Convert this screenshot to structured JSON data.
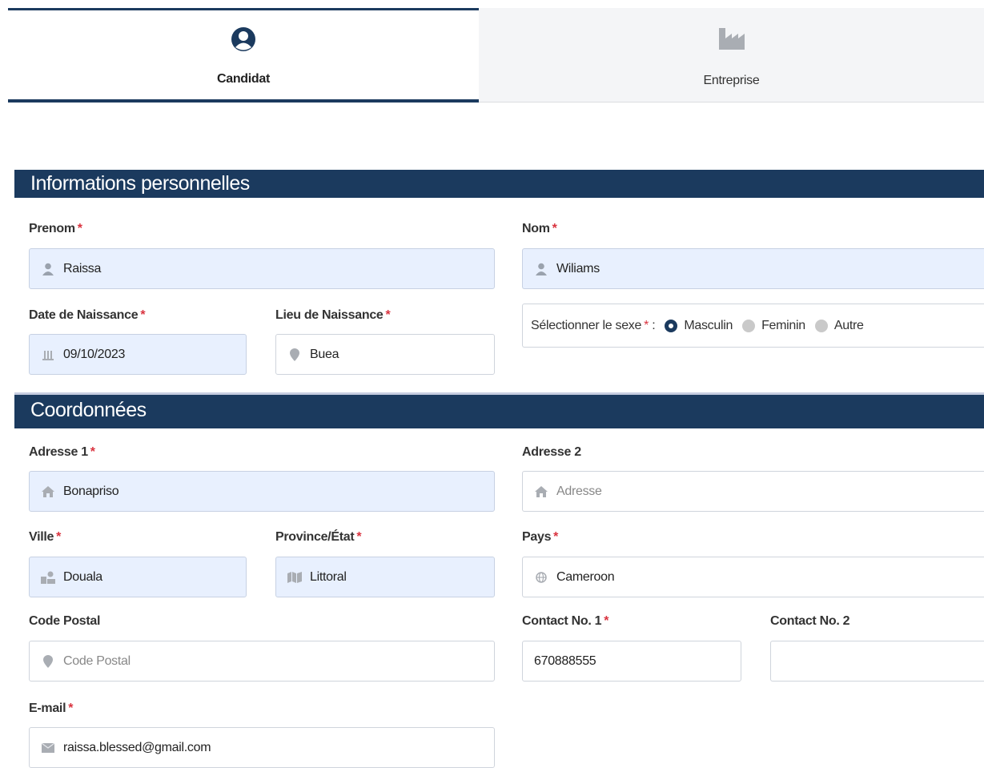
{
  "tabs": {
    "candidat": {
      "label": "Candidat",
      "icon": "user-circle-icon"
    },
    "entreprise": {
      "label": "Entreprise",
      "icon": "factory-icon"
    }
  },
  "colors": {
    "primary": "#1b3a5e",
    "required": "#d9333f",
    "filled_bg": "#e8f0fe"
  },
  "personal": {
    "title": "Informations personnelles",
    "prenom": {
      "label": "Prenom",
      "value": "Raissa",
      "icon": "user-icon"
    },
    "nom": {
      "label": "Nom",
      "value": "Wiliams",
      "icon": "user-icon"
    },
    "date_naissance": {
      "label": "Date de Naissance",
      "value": "09/10/2023",
      "icon": "calendar-icon"
    },
    "lieu_naissance": {
      "label": "Lieu de Naissance",
      "value": "Buea",
      "icon": "map-marker-icon"
    },
    "sexe": {
      "label": "Sélectionner le sexe",
      "colon": ":",
      "options": [
        "Masculin",
        "Feminin",
        "Autre"
      ],
      "selected": "Masculin"
    }
  },
  "contact": {
    "title": "Coordonnées",
    "adresse1": {
      "label": "Adresse 1",
      "value": "Bonapriso",
      "icon": "home-icon"
    },
    "adresse2": {
      "label": "Adresse 2",
      "placeholder": "Adresse",
      "icon": "home-icon"
    },
    "ville": {
      "label": "Ville",
      "value": "Douala",
      "icon": "city-icon"
    },
    "province": {
      "label": "Province/État",
      "value": "Littoral",
      "icon": "map-icon"
    },
    "pays": {
      "label": "Pays",
      "value": "Cameroon",
      "icon": "globe-icon"
    },
    "code_postal": {
      "label": "Code Postal",
      "placeholder": "Code Postal",
      "icon": "map-marker-icon"
    },
    "contact1": {
      "label": "Contact No. 1",
      "value": "670888555"
    },
    "contact2": {
      "label": "Contact No. 2",
      "value": ""
    },
    "email": {
      "label": "E-mail",
      "value": "raissa.blessed@gmail.com",
      "icon": "envelope-icon"
    }
  },
  "required_mark": "*"
}
